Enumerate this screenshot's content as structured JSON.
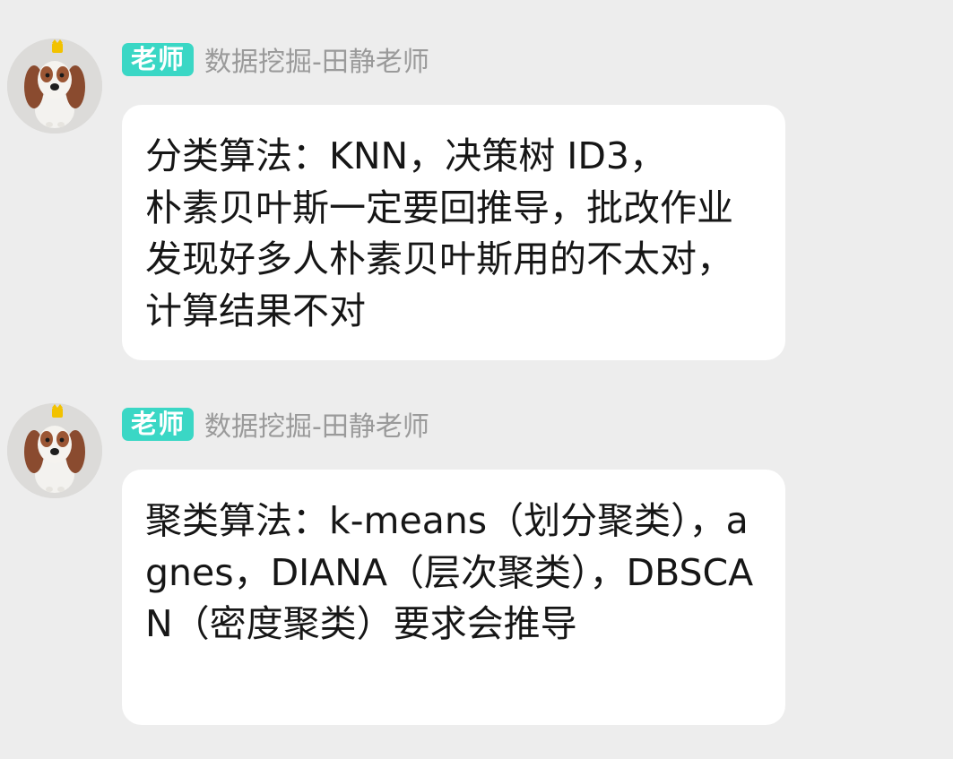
{
  "messages": [
    {
      "role_badge": "老师",
      "sender": "数据挖掘-田静老师",
      "avatar_icon": "dog-avatar-with-crown",
      "text": "分类算法：KNN，决策树 ID3，\n朴素贝叶斯一定要回推导，批改作业发现好多人朴素贝叶斯用的不太对，计算结果不对"
    },
    {
      "role_badge": "老师",
      "sender": "数据挖掘-田静老师",
      "avatar_icon": "dog-avatar-with-crown",
      "text": "聚类算法：k-means（划分聚类），agnes，DIANA（层次聚类），DBSCAN（密度聚类）要求会推导"
    }
  ],
  "colors": {
    "background": "#ededed",
    "bubble": "#ffffff",
    "badge": "#3ad7c5",
    "sender_text": "#9a9a9a",
    "message_text": "#161616"
  }
}
